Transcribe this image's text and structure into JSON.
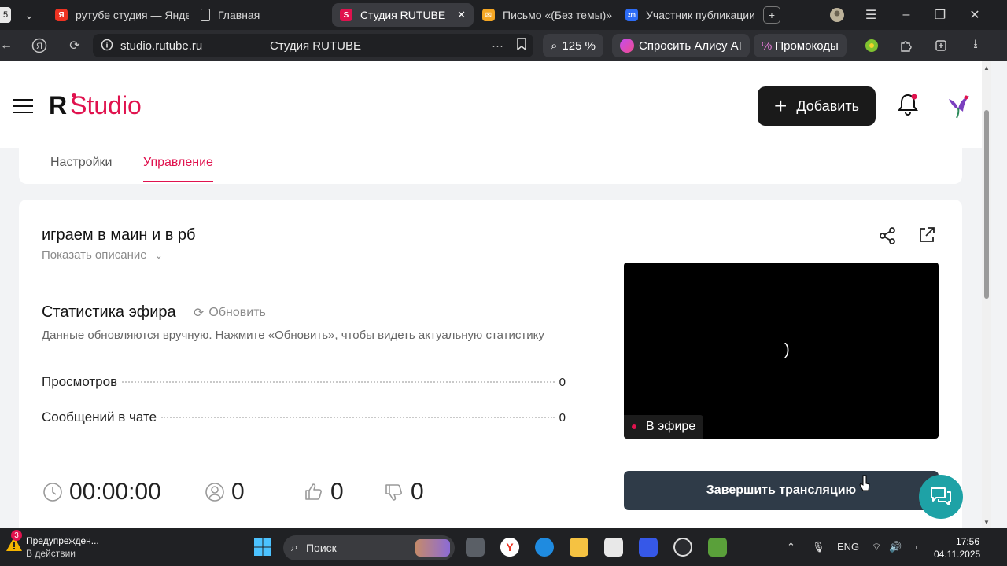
{
  "browser": {
    "tab_counter": "5",
    "tabs": [
      {
        "label": "рутубе студия — Янде",
        "icon": "yandex-icon"
      },
      {
        "label": "Главная",
        "icon": "document-icon"
      },
      {
        "label": "Студия RUTUBE",
        "icon": "rutube-studio-icon"
      },
      {
        "label": "Письмо «(Без темы)»",
        "icon": "mail-icon"
      },
      {
        "label": "Участник публикации",
        "icon": "zoom-icon"
      }
    ],
    "address": "studio.rutube.ru",
    "page_title": "Студия RUTUBE",
    "zoom": "125 %",
    "alice_label": "Спросить Алису AI",
    "promo_label": "Промокоды",
    "colors": {
      "tabbar": "#1f2023",
      "addressbar": "#2b2c30",
      "active_tab": "#3a3b40"
    }
  },
  "header": {
    "logo_r": "R",
    "logo_studio": "Studio",
    "add_button": "Добавить",
    "brand_color": "#e0124e"
  },
  "page_tabs": [
    {
      "label": "Настройки"
    },
    {
      "label": "Управление"
    }
  ],
  "stream": {
    "title": "играем в маин и в рб",
    "show_description": "Показать описание",
    "stats_title": "Статистика эфира",
    "refresh_label": "Обновить",
    "note": "Данные обновляются вручную. Нажмите «Обновить», чтобы видеть актуальную статистику",
    "stats": [
      {
        "label": "Просмотров",
        "value": "0"
      },
      {
        "label": "Сообщений в чате",
        "value": "0"
      }
    ],
    "duration": "00:00:00",
    "viewers": "0",
    "likes": "0",
    "dislikes": "0",
    "live_badge": "В эфире",
    "end_button": "Завершить трансляцию"
  },
  "taskbar": {
    "notification_count": "3",
    "notification_title": "Предупрежден...",
    "notification_sub": "В действии",
    "search_label": "Поиск",
    "lang": "ENG",
    "time": "17:56",
    "date": "04.11.2025"
  }
}
